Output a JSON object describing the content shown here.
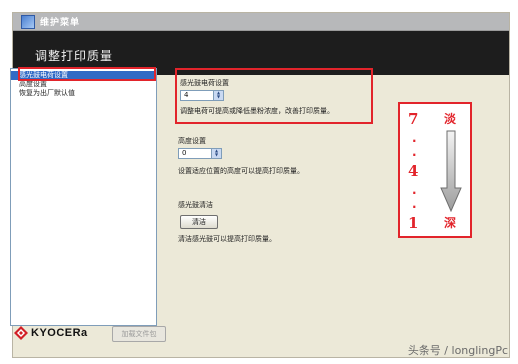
{
  "window": {
    "title": "维护菜单"
  },
  "header": {
    "title": "调整打印质量"
  },
  "sidebar": {
    "items": [
      {
        "label": "感光鼓电荷设置",
        "selected": true
      },
      {
        "label": "高度设置",
        "selected": false
      },
      {
        "label": "恢复为出厂默认值",
        "selected": false
      }
    ]
  },
  "settings": {
    "drum_charge": {
      "label": "感光鼓电荷设置",
      "value": "4",
      "description": "调整电荷可提高或降低墨粉浓度，改善打印质量。"
    },
    "altitude": {
      "label": "高度设置",
      "value": "0",
      "description": "设置适应位置的高度可以提高打印质量。"
    },
    "drum_cleaning": {
      "label": "感光鼓清洁",
      "button": "清洁",
      "description": "清洁感光鼓可以提高打印质量。"
    }
  },
  "annotation": {
    "top_number": "7",
    "middle_number": "4",
    "bottom_number": "1",
    "light_label": "淡",
    "dark_label": "深",
    "dots": "·",
    "accent_color": "#e2242b"
  },
  "footer": {
    "brand": "KYOCERa",
    "button": "加载文件包"
  },
  "watermark": "头条号 / longlingPc"
}
